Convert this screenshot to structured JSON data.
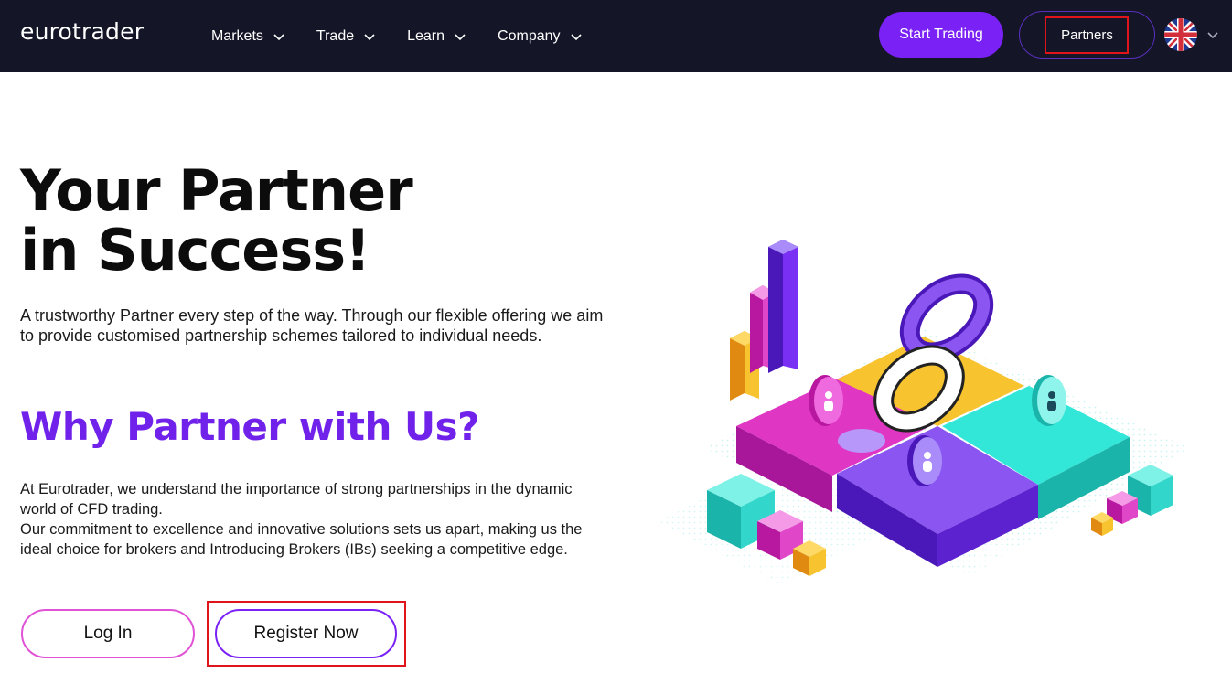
{
  "header": {
    "logo": "eurotrader",
    "nav": [
      {
        "label": "Markets"
      },
      {
        "label": "Trade"
      },
      {
        "label": "Learn"
      },
      {
        "label": "Company"
      }
    ],
    "start_trading": "Start Trading",
    "partners": "Partners",
    "language_icon": "uk-flag-icon"
  },
  "hero": {
    "title_line1": "Your Partner",
    "title_line2": "in Success!",
    "subtitle": "A trustworthy Partner every step of the way.  Through our flexible offering we aim to provide customised partnership schemes tailored to individual needs."
  },
  "why": {
    "title": "Why Partner with Us?",
    "paragraph1": "At Eurotrader, we understand the importance of strong partnerships in the dynamic world of CFD trading.",
    "paragraph2": "Our commitment to excellence and innovative solutions sets us apart, making us the ideal choice for brokers and Introducing Brokers (IBs) seeking a competitive edge."
  },
  "actions": {
    "login": "Log In",
    "register": "Register Now"
  },
  "colors": {
    "header_bg": "#141627",
    "accent_purple": "#7a22f5",
    "login_border": "#e052d6",
    "highlight_red": "#e0141b"
  }
}
